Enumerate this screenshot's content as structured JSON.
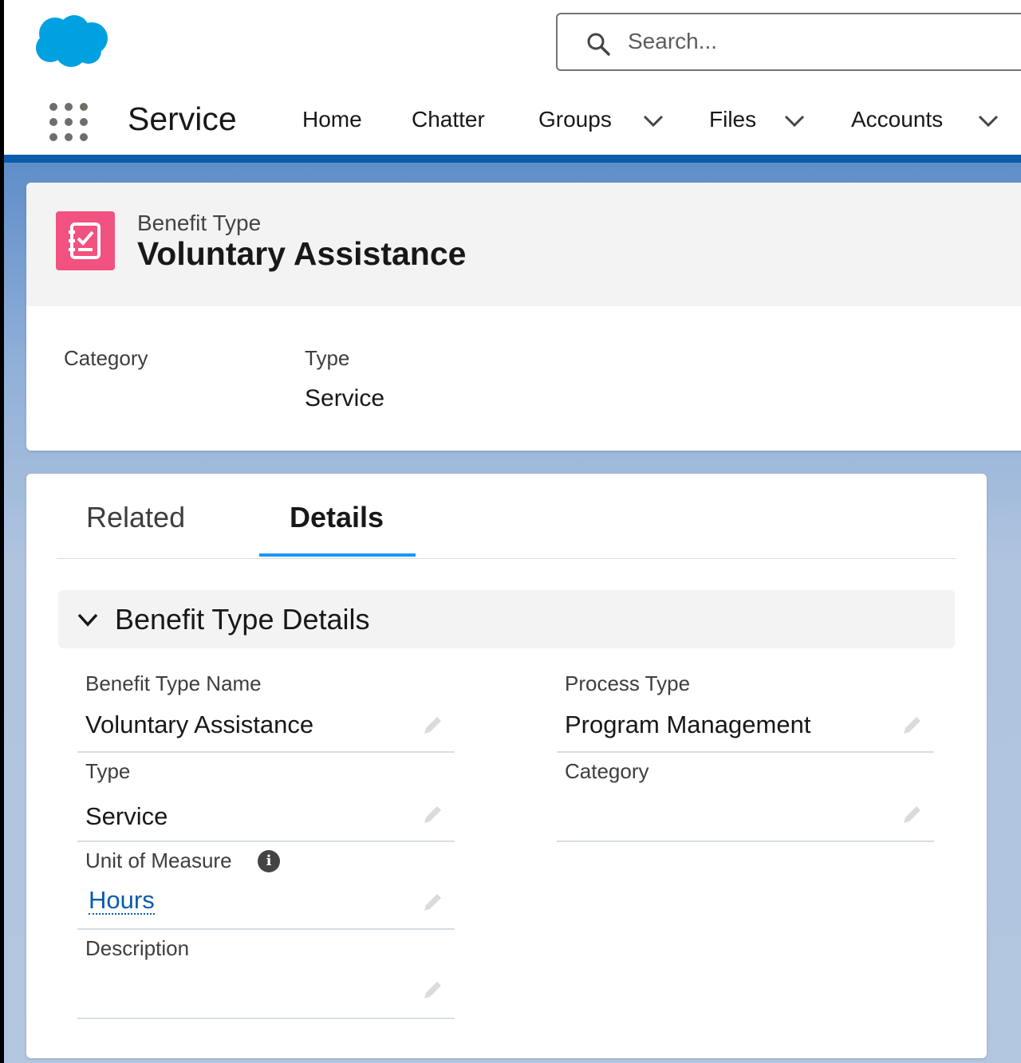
{
  "header": {
    "search_placeholder": "Search..."
  },
  "nav": {
    "app_name": "Service",
    "items": [
      {
        "label": "Home",
        "has_menu": false
      },
      {
        "label": "Chatter",
        "has_menu": false
      },
      {
        "label": "Groups",
        "has_menu": true
      },
      {
        "label": "Files",
        "has_menu": true
      },
      {
        "label": "Accounts",
        "has_menu": true
      }
    ]
  },
  "record": {
    "object_type": "Benefit Type",
    "name": "Voluntary Assistance",
    "icon": "record-checklist-icon",
    "icon_color": "#f2527f",
    "highlights": [
      {
        "label": "Category",
        "value": ""
      },
      {
        "label": "Type",
        "value": "Service"
      }
    ]
  },
  "tabs": [
    {
      "label": "Related",
      "active": false
    },
    {
      "label": "Details",
      "active": true
    }
  ],
  "section": {
    "title": "Benefit Type Details",
    "fields_left": [
      {
        "label": "Benefit Type Name",
        "value": "Voluntary Assistance"
      },
      {
        "label": "Type",
        "value": "Service"
      },
      {
        "label": "Unit of Measure",
        "value": "Hours",
        "is_link": true,
        "has_info": true
      },
      {
        "label": "Description",
        "value": ""
      }
    ],
    "fields_right": [
      {
        "label": "Process Type",
        "value": "Program Management"
      },
      {
        "label": "Category",
        "value": ""
      }
    ]
  },
  "colors": {
    "brand_blue": "#0b5cab",
    "active_tab": "#1b96ff",
    "cloud_logo": "#00a1e0"
  }
}
